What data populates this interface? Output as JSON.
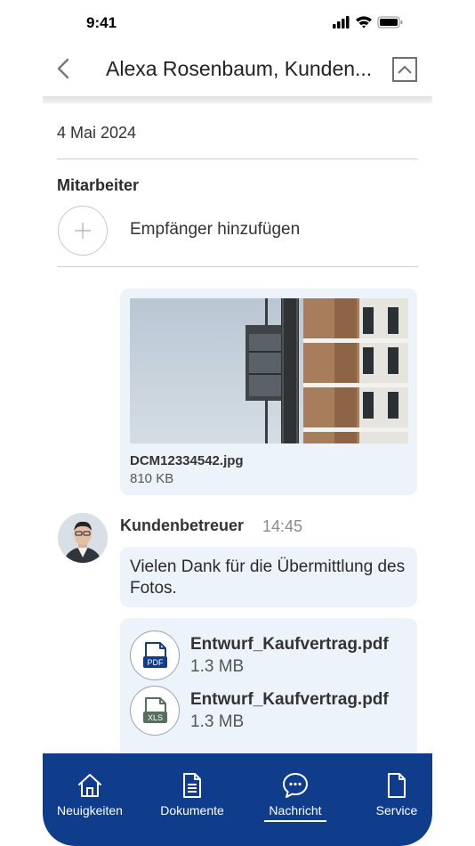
{
  "status_bar": {
    "time": "9:41",
    "icons": [
      "signal-icon",
      "wifi-icon",
      "battery-icon"
    ]
  },
  "header": {
    "title": "Alexa Rosenbaum, Kunden...",
    "back_icon": "chevron-left-icon",
    "collapse_icon": "chevron-up-square-icon"
  },
  "date": "4 Mai 2024",
  "recipients": {
    "section_title": "Mitarbeiter",
    "add_label": "Empfänger hinzufügen"
  },
  "attachment_image": {
    "file_name": "DCM12334542.jpg",
    "file_size": "810 KB"
  },
  "message": {
    "sender": "Kundenbetreuer",
    "time": "14:45",
    "text": "Vielen Dank für die Übermittlung des Fotos.",
    "files": [
      {
        "name": "Entwurf_Kaufvertrag.pdf",
        "size": "1.3 MB",
        "type_label": "PDF",
        "type_color": "#0f3d8c"
      },
      {
        "name": "Entwurf_Kaufvertrag.pdf",
        "size": "1.3 MB",
        "type_label": "XLS",
        "type_color": "#56705c"
      }
    ]
  },
  "tab_bar": {
    "active_tab": "Nachricht",
    "tabs": [
      {
        "label": "Neuigkeiten",
        "icon": "home-icon"
      },
      {
        "label": "Dokumente",
        "icon": "document-icon"
      },
      {
        "label": "Nachricht",
        "icon": "chat-bubble-icon"
      },
      {
        "label": "Service",
        "icon": "file-icon"
      }
    ]
  },
  "colors": {
    "brand_blue": "#0f3d8c",
    "bubble_background": "#edf3fb",
    "time_gray": "#8b8b8b"
  }
}
